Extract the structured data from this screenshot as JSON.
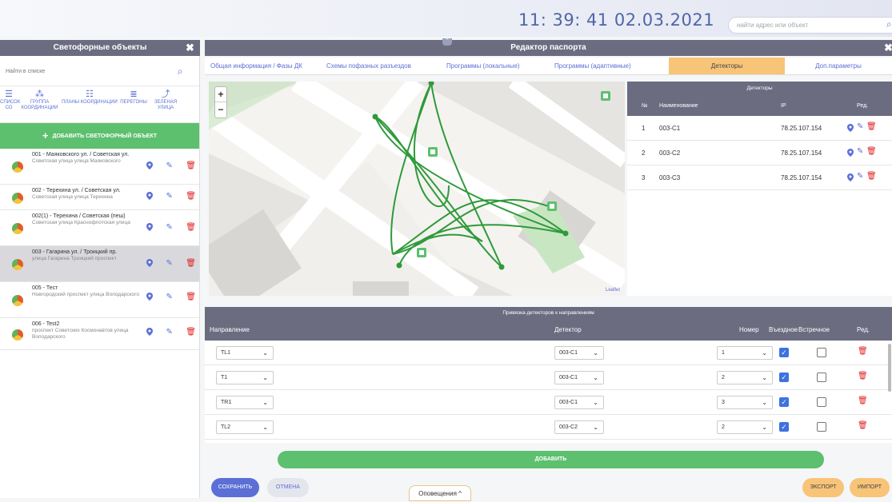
{
  "header": {
    "clock": "11: 39: 41  02.03.2021",
    "search_placeholder": "найти адрес или объект"
  },
  "left_panel": {
    "title": "Светофорные объекты",
    "search_placeholder": "Найти в списке",
    "toolbar": [
      {
        "label": "СПИСОК СО",
        "icon": "list-icon"
      },
      {
        "label": "ГРУППА КООРДИНАЦИИ",
        "icon": "group-icon"
      },
      {
        "label": "ПЛАНЫ КООРДИНАЦИИ",
        "icon": "plans-icon"
      },
      {
        "label": "ПЕРЕГОНЫ",
        "icon": "stretches-icon"
      },
      {
        "label": "ЗЕЛЕНАЯ УЛИЦА",
        "icon": "green-street-icon"
      }
    ],
    "add_button": "ДОБАВИТЬ СВЕТОФОРНЫЙ ОБЪЕКТ",
    "objects": [
      {
        "title": "001 - Маяковского ул. / Советская ул.",
        "address": "Советская улица улица Маяковского"
      },
      {
        "title": "002 - Терехина ул. / Советская ул.",
        "address": "Советская улица улица Терехина"
      },
      {
        "title": "002(1) - Терехина / Советская (пеш)",
        "address": "Советская улица Краснофлотская улица"
      },
      {
        "title": "003 - Гагарина ул. / Троицкий пр.",
        "address": "улица Гагарина Троицкий проспект"
      },
      {
        "title": "005 - Тест",
        "address": "Новгородский проспект улица Володарского"
      },
      {
        "title": "006 - Test2",
        "address": "проспект Советских Космонавтов улица Володарского"
      }
    ]
  },
  "editor": {
    "title": "Редактор паспорта",
    "tabs": [
      "Общая информация / Фазы ДК",
      "Схемы пофазных разъездов",
      "Программы (локальные)",
      "Программы (адаптивные)",
      "Детекторы",
      "Доп.параметры"
    ],
    "active_tab": 4
  },
  "map": {
    "zoom_in": "+",
    "zoom_out": "−",
    "attribution": "Leaflet"
  },
  "detectors": {
    "title": "Детекторы",
    "columns": [
      "№",
      "Наименование",
      "IP",
      "Ред."
    ],
    "rows": [
      {
        "n": "1",
        "name": "003-C1",
        "ip": "78.25.107.154"
      },
      {
        "n": "2",
        "name": "003-C2",
        "ip": "78.25.107.154"
      },
      {
        "n": "3",
        "name": "003-C3",
        "ip": "78.25.107.154"
      }
    ]
  },
  "binding": {
    "title": "Привязка детекторов к направлениям",
    "columns": [
      "Направление",
      "Детектор",
      "Номер",
      "Въездное",
      "Встречное",
      "Ред."
    ],
    "rows": [
      {
        "direction": "TL1",
        "detector": "003-C1",
        "number": "1",
        "entry": true,
        "oncoming": false
      },
      {
        "direction": "T1",
        "detector": "003-C1",
        "number": "2",
        "entry": true,
        "oncoming": false
      },
      {
        "direction": "TR1",
        "detector": "003-C1",
        "number": "3",
        "entry": true,
        "oncoming": false
      },
      {
        "direction": "TL2",
        "detector": "003-C2",
        "number": "2",
        "entry": true,
        "oncoming": false
      }
    ],
    "add_button": "ДОБАВИТЬ"
  },
  "footer": {
    "save": "СОХРАНИТЬ",
    "cancel": "ОТМЕНА",
    "notifications": "Оповещения ^",
    "export": "ЭКСПОРТ",
    "import": "ИМПОРТ"
  },
  "colors": {
    "accent": "#5b6fd6",
    "header_bg": "#6b6c80",
    "green": "#5cc06e",
    "active_tab": "#f8c478",
    "danger": "#e02020"
  }
}
